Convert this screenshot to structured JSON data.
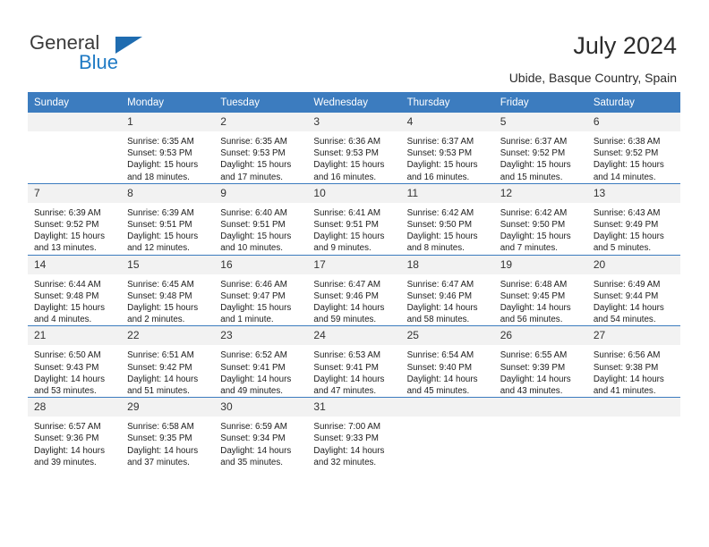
{
  "brand": {
    "name_part1": "General",
    "name_part2": "Blue",
    "triangle_icon": "triangle-icon",
    "accent_color": "#1f7ac4",
    "header_color": "#3c7cbf"
  },
  "header": {
    "title": "July 2024",
    "location": "Ubide, Basque Country, Spain"
  },
  "weekdays": [
    "Sunday",
    "Monday",
    "Tuesday",
    "Wednesday",
    "Thursday",
    "Friday",
    "Saturday"
  ],
  "weeks": [
    [
      {
        "day": "",
        "sunrise": "",
        "sunset": "",
        "daylight1": "",
        "daylight2": "",
        "empty": true
      },
      {
        "day": "1",
        "sunrise": "Sunrise: 6:35 AM",
        "sunset": "Sunset: 9:53 PM",
        "daylight1": "Daylight: 15 hours",
        "daylight2": "and 18 minutes."
      },
      {
        "day": "2",
        "sunrise": "Sunrise: 6:35 AM",
        "sunset": "Sunset: 9:53 PM",
        "daylight1": "Daylight: 15 hours",
        "daylight2": "and 17 minutes."
      },
      {
        "day": "3",
        "sunrise": "Sunrise: 6:36 AM",
        "sunset": "Sunset: 9:53 PM",
        "daylight1": "Daylight: 15 hours",
        "daylight2": "and 16 minutes."
      },
      {
        "day": "4",
        "sunrise": "Sunrise: 6:37 AM",
        "sunset": "Sunset: 9:53 PM",
        "daylight1": "Daylight: 15 hours",
        "daylight2": "and 16 minutes."
      },
      {
        "day": "5",
        "sunrise": "Sunrise: 6:37 AM",
        "sunset": "Sunset: 9:52 PM",
        "daylight1": "Daylight: 15 hours",
        "daylight2": "and 15 minutes."
      },
      {
        "day": "6",
        "sunrise": "Sunrise: 6:38 AM",
        "sunset": "Sunset: 9:52 PM",
        "daylight1": "Daylight: 15 hours",
        "daylight2": "and 14 minutes."
      }
    ],
    [
      {
        "day": "7",
        "sunrise": "Sunrise: 6:39 AM",
        "sunset": "Sunset: 9:52 PM",
        "daylight1": "Daylight: 15 hours",
        "daylight2": "and 13 minutes."
      },
      {
        "day": "8",
        "sunrise": "Sunrise: 6:39 AM",
        "sunset": "Sunset: 9:51 PM",
        "daylight1": "Daylight: 15 hours",
        "daylight2": "and 12 minutes."
      },
      {
        "day": "9",
        "sunrise": "Sunrise: 6:40 AM",
        "sunset": "Sunset: 9:51 PM",
        "daylight1": "Daylight: 15 hours",
        "daylight2": "and 10 minutes."
      },
      {
        "day": "10",
        "sunrise": "Sunrise: 6:41 AM",
        "sunset": "Sunset: 9:51 PM",
        "daylight1": "Daylight: 15 hours",
        "daylight2": "and 9 minutes."
      },
      {
        "day": "11",
        "sunrise": "Sunrise: 6:42 AM",
        "sunset": "Sunset: 9:50 PM",
        "daylight1": "Daylight: 15 hours",
        "daylight2": "and 8 minutes."
      },
      {
        "day": "12",
        "sunrise": "Sunrise: 6:42 AM",
        "sunset": "Sunset: 9:50 PM",
        "daylight1": "Daylight: 15 hours",
        "daylight2": "and 7 minutes."
      },
      {
        "day": "13",
        "sunrise": "Sunrise: 6:43 AM",
        "sunset": "Sunset: 9:49 PM",
        "daylight1": "Daylight: 15 hours",
        "daylight2": "and 5 minutes."
      }
    ],
    [
      {
        "day": "14",
        "sunrise": "Sunrise: 6:44 AM",
        "sunset": "Sunset: 9:48 PM",
        "daylight1": "Daylight: 15 hours",
        "daylight2": "and 4 minutes."
      },
      {
        "day": "15",
        "sunrise": "Sunrise: 6:45 AM",
        "sunset": "Sunset: 9:48 PM",
        "daylight1": "Daylight: 15 hours",
        "daylight2": "and 2 minutes."
      },
      {
        "day": "16",
        "sunrise": "Sunrise: 6:46 AM",
        "sunset": "Sunset: 9:47 PM",
        "daylight1": "Daylight: 15 hours",
        "daylight2": "and 1 minute."
      },
      {
        "day": "17",
        "sunrise": "Sunrise: 6:47 AM",
        "sunset": "Sunset: 9:46 PM",
        "daylight1": "Daylight: 14 hours",
        "daylight2": "and 59 minutes."
      },
      {
        "day": "18",
        "sunrise": "Sunrise: 6:47 AM",
        "sunset": "Sunset: 9:46 PM",
        "daylight1": "Daylight: 14 hours",
        "daylight2": "and 58 minutes."
      },
      {
        "day": "19",
        "sunrise": "Sunrise: 6:48 AM",
        "sunset": "Sunset: 9:45 PM",
        "daylight1": "Daylight: 14 hours",
        "daylight2": "and 56 minutes."
      },
      {
        "day": "20",
        "sunrise": "Sunrise: 6:49 AM",
        "sunset": "Sunset: 9:44 PM",
        "daylight1": "Daylight: 14 hours",
        "daylight2": "and 54 minutes."
      }
    ],
    [
      {
        "day": "21",
        "sunrise": "Sunrise: 6:50 AM",
        "sunset": "Sunset: 9:43 PM",
        "daylight1": "Daylight: 14 hours",
        "daylight2": "and 53 minutes."
      },
      {
        "day": "22",
        "sunrise": "Sunrise: 6:51 AM",
        "sunset": "Sunset: 9:42 PM",
        "daylight1": "Daylight: 14 hours",
        "daylight2": "and 51 minutes."
      },
      {
        "day": "23",
        "sunrise": "Sunrise: 6:52 AM",
        "sunset": "Sunset: 9:41 PM",
        "daylight1": "Daylight: 14 hours",
        "daylight2": "and 49 minutes."
      },
      {
        "day": "24",
        "sunrise": "Sunrise: 6:53 AM",
        "sunset": "Sunset: 9:41 PM",
        "daylight1": "Daylight: 14 hours",
        "daylight2": "and 47 minutes."
      },
      {
        "day": "25",
        "sunrise": "Sunrise: 6:54 AM",
        "sunset": "Sunset: 9:40 PM",
        "daylight1": "Daylight: 14 hours",
        "daylight2": "and 45 minutes."
      },
      {
        "day": "26",
        "sunrise": "Sunrise: 6:55 AM",
        "sunset": "Sunset: 9:39 PM",
        "daylight1": "Daylight: 14 hours",
        "daylight2": "and 43 minutes."
      },
      {
        "day": "27",
        "sunrise": "Sunrise: 6:56 AM",
        "sunset": "Sunset: 9:38 PM",
        "daylight1": "Daylight: 14 hours",
        "daylight2": "and 41 minutes."
      }
    ],
    [
      {
        "day": "28",
        "sunrise": "Sunrise: 6:57 AM",
        "sunset": "Sunset: 9:36 PM",
        "daylight1": "Daylight: 14 hours",
        "daylight2": "and 39 minutes."
      },
      {
        "day": "29",
        "sunrise": "Sunrise: 6:58 AM",
        "sunset": "Sunset: 9:35 PM",
        "daylight1": "Daylight: 14 hours",
        "daylight2": "and 37 minutes."
      },
      {
        "day": "30",
        "sunrise": "Sunrise: 6:59 AM",
        "sunset": "Sunset: 9:34 PM",
        "daylight1": "Daylight: 14 hours",
        "daylight2": "and 35 minutes."
      },
      {
        "day": "31",
        "sunrise": "Sunrise: 7:00 AM",
        "sunset": "Sunset: 9:33 PM",
        "daylight1": "Daylight: 14 hours",
        "daylight2": "and 32 minutes."
      },
      {
        "day": "",
        "sunrise": "",
        "sunset": "",
        "daylight1": "",
        "daylight2": "",
        "empty": true
      },
      {
        "day": "",
        "sunrise": "",
        "sunset": "",
        "daylight1": "",
        "daylight2": "",
        "empty": true
      },
      {
        "day": "",
        "sunrise": "",
        "sunset": "",
        "daylight1": "",
        "daylight2": "",
        "empty": true
      }
    ]
  ]
}
